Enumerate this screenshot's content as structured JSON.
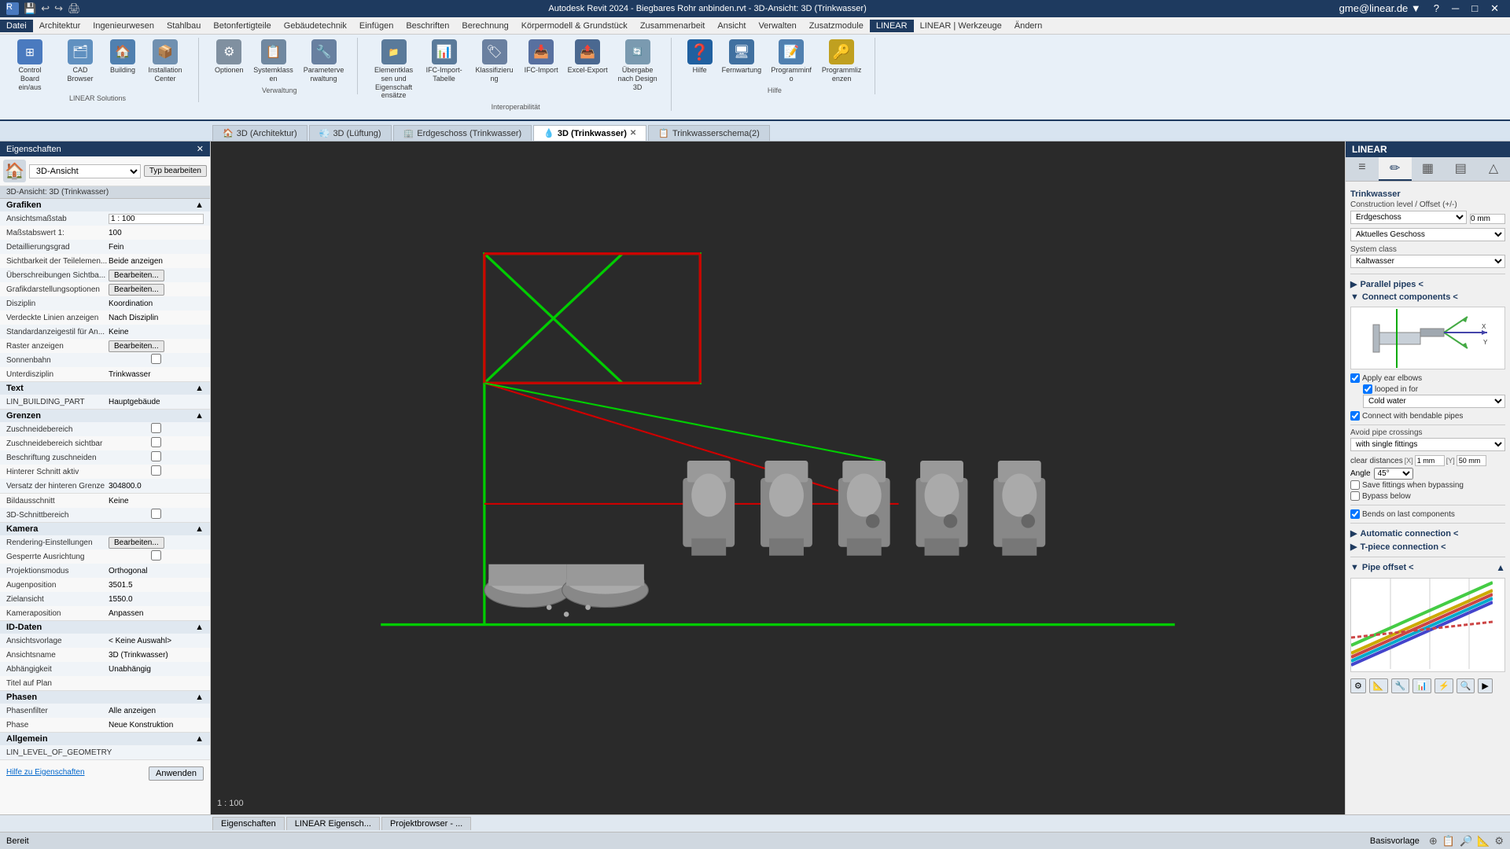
{
  "app": {
    "title": "Autodesk Revit 2024 - Biegbares Rohr anbinden.rvt - 3D-Ansicht: 3D (Trinkwasser)",
    "status": "Bereit"
  },
  "menubar": {
    "items": [
      "Datei",
      "Architektur",
      "Ingenieurwesen",
      "Stahlbau",
      "Betonfertigteile",
      "Gebäudetechnik",
      "Einfügen",
      "Beschriften",
      "Berechnung",
      "Körpermodell & Grundstück",
      "Zusammenarbeit",
      "Ansicht",
      "Verwalten",
      "Zusatzmodule",
      "LINEAR",
      "LINEAR | Werkzeuge",
      "Ändern"
    ]
  },
  "ribbon": {
    "groups": [
      {
        "label": "LINEAR Solutions",
        "items": [
          {
            "icon": "⊞",
            "label": "Control Board ein/aus"
          },
          {
            "icon": "🗂",
            "label": "CAD Browser"
          },
          {
            "icon": "🏠",
            "label": "Building"
          },
          {
            "icon": "📦",
            "label": "Installation Center"
          }
        ]
      },
      {
        "label": "Verwaltung",
        "items": [
          {
            "icon": "⚙",
            "label": "Optionen"
          },
          {
            "icon": "📋",
            "label": "Systemklassen"
          },
          {
            "icon": "🔧",
            "label": "Parameterverwaltung"
          }
        ]
      },
      {
        "label": "",
        "items": [
          {
            "icon": "📁",
            "label": "Elementklassen und Eigenschaftensätze"
          },
          {
            "icon": "📊",
            "label": "IFC-Import-Tabelle"
          },
          {
            "icon": "🏷",
            "label": "Klassifizierung"
          },
          {
            "icon": "📥",
            "label": "IFC-Import"
          },
          {
            "icon": "📤",
            "label": "Excel-Export"
          },
          {
            "icon": "🔄",
            "label": "Übergabe nach Design 3D"
          }
        ]
      },
      {
        "label": "Interoperabilität",
        "items": []
      },
      {
        "label": "Hilfe",
        "items": [
          {
            "icon": "❓",
            "label": "Hilfe"
          },
          {
            "icon": "🖥",
            "label": "Fernwartung"
          },
          {
            "icon": "📝",
            "label": "Programminfo"
          },
          {
            "icon": "🔑",
            "label": "Programmlizenzen"
          }
        ]
      }
    ]
  },
  "tabs": [
    {
      "label": "3D (Architektur)",
      "icon": "🏠",
      "active": false,
      "closable": false
    },
    {
      "label": "3D (Lüftung)",
      "icon": "💨",
      "active": false,
      "closable": false
    },
    {
      "label": "Erdgeschoss (Trinkwasser)",
      "icon": "🏢",
      "active": false,
      "closable": false
    },
    {
      "label": "3D (Trinkwasser)",
      "icon": "💧",
      "active": true,
      "closable": true
    },
    {
      "label": "Trinkwasserschema(2)",
      "icon": "📋",
      "active": false,
      "closable": false
    }
  ],
  "leftPanel": {
    "title": "Eigenschaften",
    "viewLabel": "3D-Ansicht",
    "viewDropdown": "3D-Ansicht: 3D (Trinkwasser)",
    "subheader": "3D-Ansicht: 3D (Trinkwasser)",
    "editTypeBtn": "Typ bearbeiten",
    "sections": [
      {
        "title": "Grafiken",
        "rows": [
          {
            "label": "Ansichtsmaßstab",
            "value": "1 : 100",
            "input": true
          },
          {
            "label": "Maßstabswert 1:",
            "value": "100"
          },
          {
            "label": "Detaillierungsgrad",
            "value": "Fein"
          },
          {
            "label": "Sichtbarkeit der Teilelemen...",
            "value": "Beide anzeigen"
          },
          {
            "label": "Überschreibungen Sichtba...",
            "value": "",
            "btn": "Bearbeiten..."
          },
          {
            "label": "Grafikdarstellungsoptionen",
            "value": "",
            "btn": "Bearbeiten..."
          },
          {
            "label": "Disziplin",
            "value": "Koordination"
          },
          {
            "label": "Verdeckte Linien anzeigen",
            "value": "Nach Disziplin"
          },
          {
            "label": "Standardanzeigestil für An...",
            "value": "Keine"
          },
          {
            "label": "Raster anzeigen",
            "value": "",
            "btn": "Bearbeiten..."
          },
          {
            "label": "Sonnenbahn",
            "value": "",
            "checkbox": true
          },
          {
            "label": "Unterdisziplin",
            "value": "Trinkwasser"
          }
        ]
      },
      {
        "title": "Text",
        "rows": [
          {
            "label": "LIN_BUILDING_PART",
            "value": "Hauptgebäude"
          }
        ]
      },
      {
        "title": "Grenzen",
        "rows": [
          {
            "label": "Zuschneidebereich",
            "value": "",
            "checkbox": true
          },
          {
            "label": "Zuschneidebereich sichtbar",
            "value": "",
            "checkbox": true
          },
          {
            "label": "Beschriftung zuschneiden",
            "value": "",
            "checkbox": true
          },
          {
            "label": "Hinterer Schnitt aktiv",
            "value": "",
            "checkbox": true
          },
          {
            "label": "Versatz der hinteren Grenze",
            "value": "304800.0"
          }
        ]
      },
      {
        "title": "",
        "rows": [
          {
            "label": "Bildausschnitt",
            "value": "Keine"
          },
          {
            "label": "3D-Schnittbereich",
            "value": "",
            "checkbox": true
          }
        ]
      },
      {
        "title": "Kamera",
        "rows": [
          {
            "label": "Rendering-Einstellungen",
            "value": "",
            "btn": "Bearbeiten..."
          },
          {
            "label": "Gesperrte Ausrichtung",
            "value": "",
            "checkbox": true
          },
          {
            "label": "Projektionsmodus",
            "value": "Orthogonal"
          },
          {
            "label": "Augenposition",
            "value": "3501.5"
          },
          {
            "label": "Zielansicht",
            "value": "1550.0"
          },
          {
            "label": "Kameraposition",
            "value": "Anpassen"
          }
        ]
      },
      {
        "title": "ID-Daten",
        "rows": [
          {
            "label": "Ansichtsvorlage",
            "value": "< Keine Auswahl>"
          },
          {
            "label": "Ansichtsname",
            "value": "3D (Trinkwasser)"
          },
          {
            "label": "Abhängigkeit",
            "value": "Unabhängig"
          },
          {
            "label": "Titel auf Plan",
            "value": ""
          }
        ]
      },
      {
        "title": "Phasen",
        "rows": [
          {
            "label": "Phasenfilter",
            "value": "Alle anzeigen"
          },
          {
            "label": "Phase",
            "value": "Neue Konstruktion"
          }
        ]
      },
      {
        "title": "Allgemein",
        "rows": [
          {
            "label": "LIN_LEVEL_OF_GEOMETRY",
            "value": ""
          }
        ]
      }
    ],
    "hintLink": "Hilfe zu Eigenschaften",
    "applyBtn": "Anwenden"
  },
  "rightPanel": {
    "title": "LINEAR",
    "tabs": [
      "≡",
      "✏",
      "▦",
      "▤",
      "△"
    ],
    "trinkwasser": "Trinkwasser",
    "constructionLevel": "Construction level / Offset (+/-)",
    "levelSelect": "Erdgeschoss",
    "levelOffset": "0 mm",
    "actualFloor": "Aktuelles Geschoss",
    "systemClass": "System class",
    "systemClassSelect": "Kaltwasser",
    "parallelPipes": "Parallel pipes <",
    "connectComponents": "Connect components <",
    "applyEarElbows": "Apply ear elbows",
    "loopedInFor": "looped in for",
    "coldWater": "Cold water",
    "connectBendable": "Connect with bendable pipes",
    "avoidPipeCrossings": "Avoid pipe crossings",
    "withSingleFittings": "with single fittings",
    "clearDistances": "clear distances",
    "distX": "1 mm",
    "distY": "50 mm",
    "angle": "Angle",
    "angleValue": "45°",
    "saveFittings": "Save fittings when bypassing",
    "bypassBelow": "Bypass below",
    "bendsOnLast": "Bends on last components",
    "automaticConnection": "Automatic connection <",
    "tPieceConnection": "T-piece connection <",
    "pipeOffset": "Pipe offset <"
  },
  "viewport": {
    "scale": "1 : 100",
    "background": "#2a2a2a"
  },
  "statusbar": {
    "status": "Bereit",
    "baseTemplate": "Basisvorlage"
  },
  "bottomTabs": [
    {
      "label": "Eigenschaften",
      "active": false
    },
    {
      "label": "LINEAR Eigensch...",
      "active": false
    },
    {
      "label": "Projektbrowser - ...",
      "active": false
    }
  ]
}
